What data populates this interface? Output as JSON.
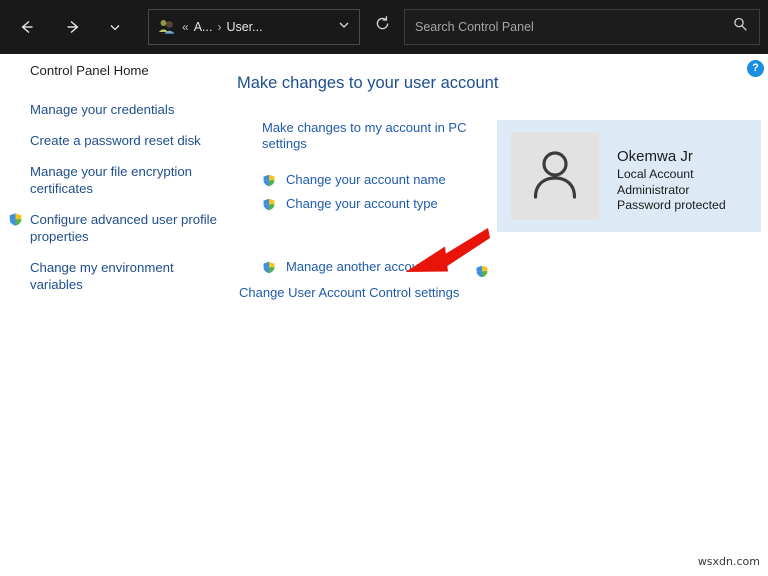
{
  "titlebar": {
    "nav": {
      "back_icon": "arrow-left-icon",
      "forward_icon": "arrow-right-icon",
      "recent_icon": "chevron-down-icon",
      "up_icon": "arrow-up-icon",
      "refresh_icon": "refresh-icon"
    },
    "address": {
      "icon": "user-accounts-icon",
      "overflow": "«",
      "segment1": "A...",
      "separator": "›",
      "segment2": "User...",
      "chevron_icon": "chevron-down-icon"
    },
    "search": {
      "placeholder": "Search Control Panel",
      "value": "",
      "icon": "search-icon"
    }
  },
  "help": {
    "label": "?",
    "name": "help-button",
    "color": "#1a8fe0"
  },
  "sidebar": {
    "items": [
      {
        "label": "Control Panel Home",
        "shield": false
      },
      {
        "label": "Manage your credentials",
        "shield": false
      },
      {
        "label": "Create a password reset disk",
        "shield": false
      },
      {
        "label": "Manage your file encryption certificates",
        "shield": false
      },
      {
        "label": "Configure advanced user profile properties",
        "shield": true
      },
      {
        "label": "Change my environment variables",
        "shield": false
      }
    ]
  },
  "main": {
    "title": "Make changes to your user account",
    "links": [
      {
        "label": "Make changes to my account in PC settings",
        "shield": false
      },
      {
        "label": "Change your account name",
        "shield": true
      },
      {
        "label": "Change your account type",
        "shield": true
      },
      {
        "label": "Manage another account",
        "shield": true
      },
      {
        "label": "Change User Account Control settings",
        "shield": true
      }
    ]
  },
  "account": {
    "avatar_icon": "user-avatar-icon",
    "name": "Okemwa Jr",
    "details": [
      "Local Account",
      "Administrator",
      "Password protected"
    ],
    "panel_color": "#ddeaf6"
  },
  "annotation": {
    "arrow_icon": "red-arrow-icon",
    "color": "#e8140a",
    "points_to": "Manage another account"
  },
  "watermark": {
    "text": "wsxdn.com"
  }
}
